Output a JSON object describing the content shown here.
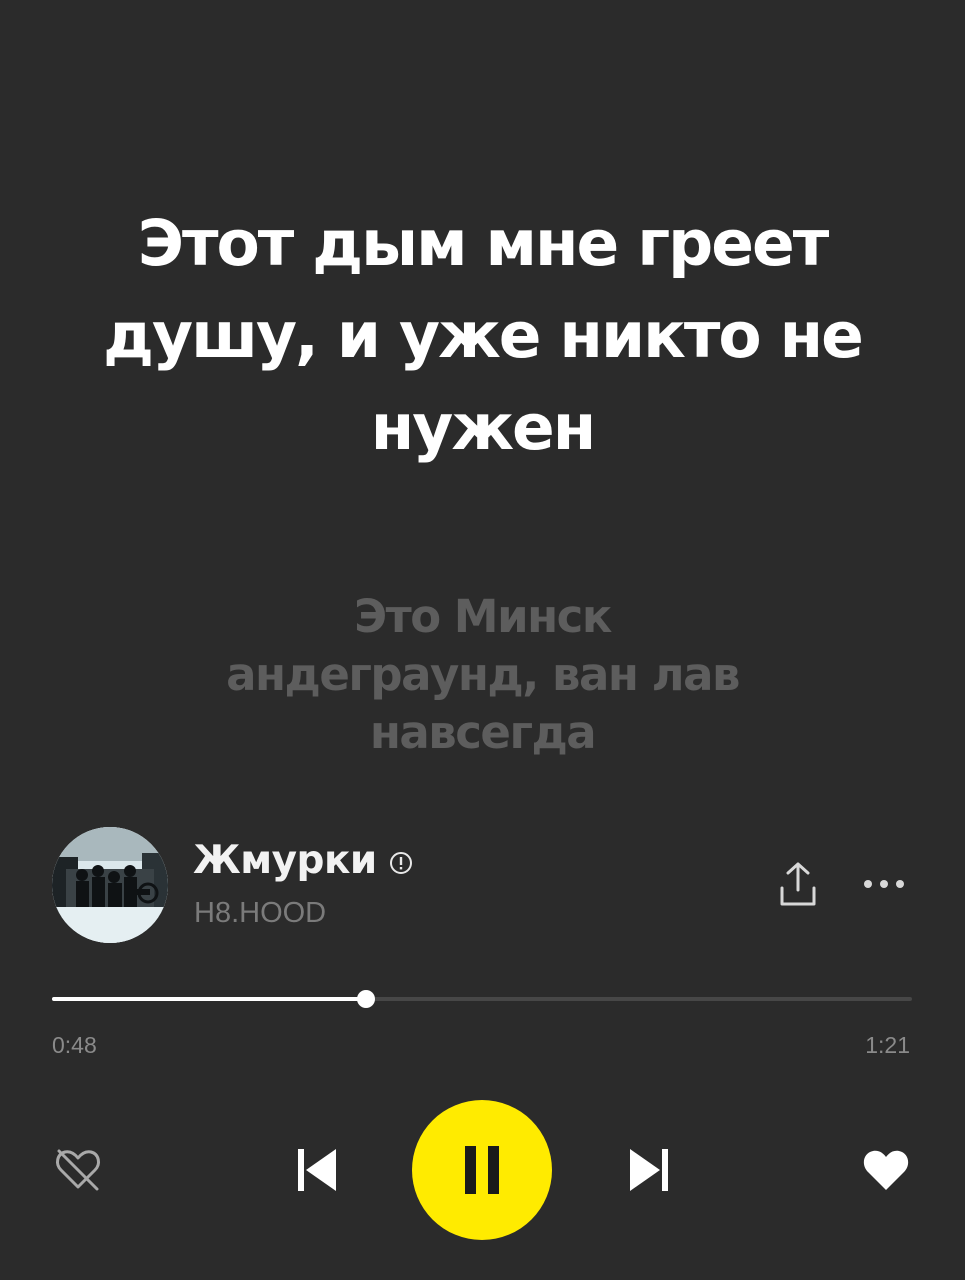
{
  "lyrics": {
    "current": "Этот дым мне греет душу, и уже никто не нужен",
    "next": "Это Минск андеграунд, ван лав навсегда"
  },
  "track": {
    "title": "Жмурки",
    "artist": "H8.HOOD",
    "explicit": true
  },
  "playback": {
    "elapsed": "0:48",
    "total": "1:21",
    "progress_fraction": 0.365,
    "state": "playing"
  },
  "colors": {
    "background": "#2b2b2b",
    "accent_play": "#ffeb00",
    "lyric_current": "#ffffff",
    "lyric_next": "#5d5d5d",
    "artist_text": "#7b7b7b"
  },
  "icons": {
    "share": "share-icon",
    "more": "more-icon",
    "dislike": "dislike-icon",
    "previous": "previous-icon",
    "pause": "pause-icon",
    "next": "next-icon",
    "like": "heart-icon",
    "explicit": "explicit-icon"
  }
}
